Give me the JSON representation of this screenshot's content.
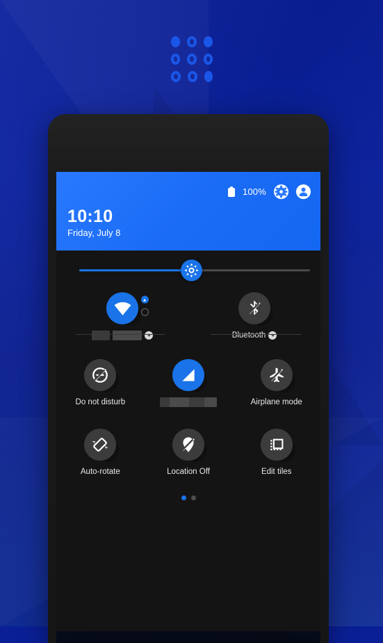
{
  "app": {
    "logo_name": "dot-grid-logo",
    "logo_dots": [
      [
        "filled",
        "ring",
        "filled"
      ],
      [
        "ring",
        "ring",
        "ring"
      ],
      [
        "ring",
        "ring",
        "filled"
      ]
    ],
    "accent_blue": "#1a73e8",
    "header_blue": "#2979ff",
    "background_blue": "#0a1f9c"
  },
  "statusbar": {
    "battery_icon": "battery-full-icon",
    "battery_percent": "100%",
    "settings_icon": "gear-icon",
    "user_icon": "user-avatar-icon"
  },
  "clock": {
    "time": "10:10",
    "date": "Friday, July 8"
  },
  "brightness": {
    "icon": "brightness-icon",
    "value_percent": 47,
    "label": "Brightness"
  },
  "tiles": {
    "row1": [
      {
        "name": "wifi",
        "label": "",
        "label_redacted": true,
        "redact_blocks": [
          26,
          42
        ],
        "icon": "wifi-icon",
        "state": "on",
        "has_chevron": true,
        "side_toggles": [
          "dot-on-arrow",
          "dot-off-ring"
        ]
      },
      {
        "name": "bluetooth",
        "label": "Bluetooth",
        "label_redacted": false,
        "icon": "bluetooth-off-icon",
        "state": "off",
        "has_chevron": true
      }
    ],
    "row2": [
      {
        "name": "do-not-disturb",
        "label": "Do not disturb",
        "icon": "do-not-disturb-icon",
        "state": "off"
      },
      {
        "name": "data-saver",
        "label": "",
        "label_redacted": true,
        "redact_blocks": [
          14,
          28,
          22,
          18
        ],
        "icon": "signal-triangle-icon",
        "state": "on"
      },
      {
        "name": "airplane-mode",
        "label": "Airplane mode",
        "icon": "airplane-off-icon",
        "state": "off"
      }
    ],
    "row3": [
      {
        "name": "auto-rotate",
        "label": "Auto-rotate",
        "icon": "screen-rotation-icon",
        "state": "off"
      },
      {
        "name": "location",
        "label": "Location Off",
        "icon": "location-off-icon",
        "state": "off"
      },
      {
        "name": "edit-tiles",
        "label": "Edit tiles",
        "icon": "edit-tiles-icon",
        "state": "off"
      }
    ]
  },
  "pager": {
    "pages": 2,
    "active": 1
  }
}
